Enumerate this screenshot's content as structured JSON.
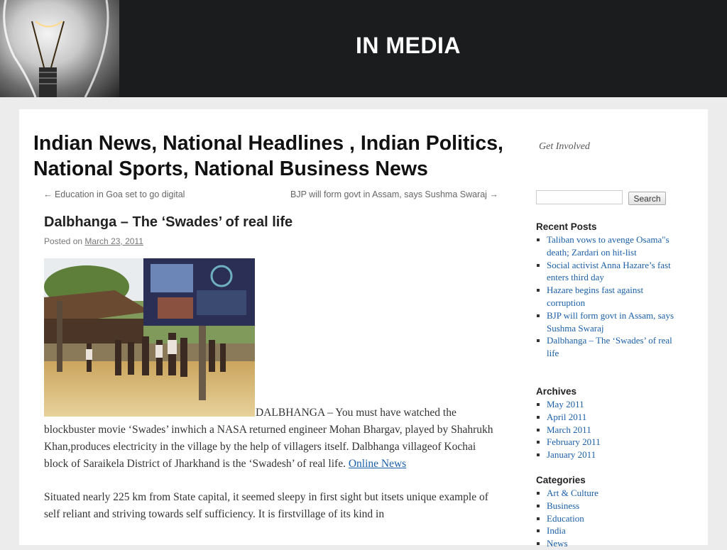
{
  "header": {
    "title": "IN MEDIA"
  },
  "site": {
    "title": "Indian News, National Headlines , Indian Politics, National Sports, National Business News",
    "get_involved": "Get Involved"
  },
  "post_nav": {
    "previous": "← Education in Goa set to go digital",
    "next": "BJP will form govt in Assam, says Sushma Swaraj →"
  },
  "post": {
    "title": "Dalbhanga – The ‘Swades’ of real life",
    "posted_on_label": "Posted on",
    "date": "March 23, 2011",
    "paragraph1_text": "DALBHANGA – You must have watched the blockbuster movie ‘Swades’ inwhich a NASA returned engineer Mohan Bhargav, played by Shahrukh Khan,produces electricity in the village by the help of villagers itself. Dalbhanga villageof Kochai block of Saraikela District of Jharkhand is the ‘Swadesh’ of real life.",
    "paragraph1_link": "Online News",
    "paragraph2": "Situated nearly 225 km from State capital, it seemed sleepy in first sight but itsets unique example of self reliant and striving towards self sufficiency. It is firstvillage of its kind in"
  },
  "sidebar": {
    "search": {
      "value": "",
      "button_label": "Search"
    },
    "recent_posts": {
      "title": "Recent Posts",
      "items": [
        "Taliban vows to avenge Osama\"s death; Zardari on hit-list",
        "Social activist Anna Hazare’s fast enters third day",
        "Hazare begins fast against corruption",
        "BJP will form govt in Assam, says Sushma Swaraj",
        "Dalbhanga – The ‘Swades’ of real life"
      ]
    },
    "archives": {
      "title": "Archives",
      "items": [
        "May 2011",
        "April 2011",
        "March 2011",
        "February 2011",
        "January 2011"
      ]
    },
    "categories": {
      "title": "Categories",
      "items": [
        "Art & Culture",
        "Business",
        "Education",
        "India",
        "News"
      ]
    }
  }
}
